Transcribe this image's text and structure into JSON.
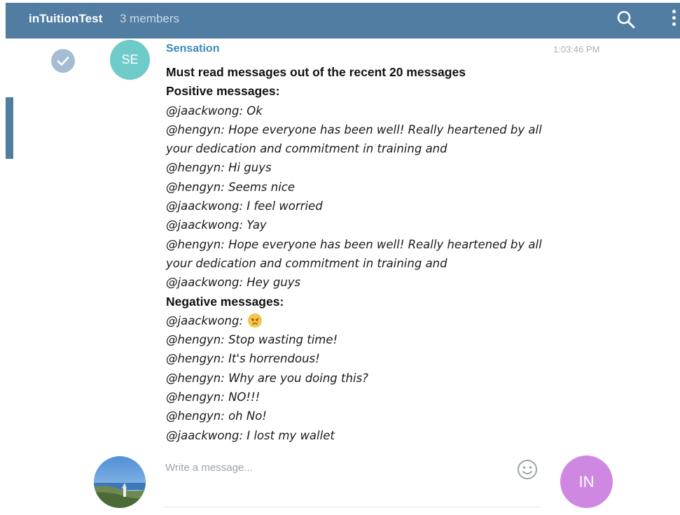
{
  "header": {
    "title": "inTuitionTest",
    "members": "3 members",
    "bg_color": "#527da3",
    "search_icon": "search-icon",
    "menu_icon": "more-vertical-icon"
  },
  "message": {
    "avatar_initials": "SE",
    "avatar_color": "#6ecbc9",
    "sender": "Sensation",
    "time": "1:03:46 PM",
    "lines": [
      {
        "text": "Must read messages out of the recent 20 messages",
        "style": "heading"
      },
      {
        "text": "Positive messages:",
        "style": "heading"
      },
      {
        "text": "@jaackwong: Ok",
        "style": "quote"
      },
      {
        "text": "@hengyn: Hope everyone has been well! Really heartened by all",
        "style": "quote"
      },
      {
        "text": "your dedication and commitment in training and",
        "style": "quote"
      },
      {
        "text": "@hengyn: Hi guys",
        "style": "quote"
      },
      {
        "text": "@hengyn: Seems nice",
        "style": "quote"
      },
      {
        "text": "@jaackwong: I feel worried",
        "style": "quote"
      },
      {
        "text": "@jaackwong: Yay",
        "style": "quote"
      },
      {
        "text": "@hengyn: Hope everyone has been well! Really heartened by all",
        "style": "quote"
      },
      {
        "text": "your dedication and commitment in training and",
        "style": "quote"
      },
      {
        "text": "@jaackwong: Hey guys",
        "style": "quote"
      },
      {
        "text": "Negative messages:",
        "style": "heading"
      },
      {
        "text": "@jaackwong: ",
        "style": "quote",
        "emoji": "angry-face-emoji"
      },
      {
        "text": "@hengyn: Stop wasting time!",
        "style": "quote"
      },
      {
        "text": "@hengyn: It's horrendous!",
        "style": "quote"
      },
      {
        "text": "@hengyn: Why are you doing this?",
        "style": "quote"
      },
      {
        "text": "@hengyn: NO!!!",
        "style": "quote"
      },
      {
        "text": "@hengyn: oh  No!",
        "style": "quote"
      },
      {
        "text": "@jaackwong: I lost my wallet",
        "style": "quote"
      }
    ]
  },
  "composer": {
    "placeholder": "Write a message...",
    "emoji_icon": "smiley-icon",
    "recipient_initials": "IN",
    "recipient_color": "#cf88e2"
  }
}
